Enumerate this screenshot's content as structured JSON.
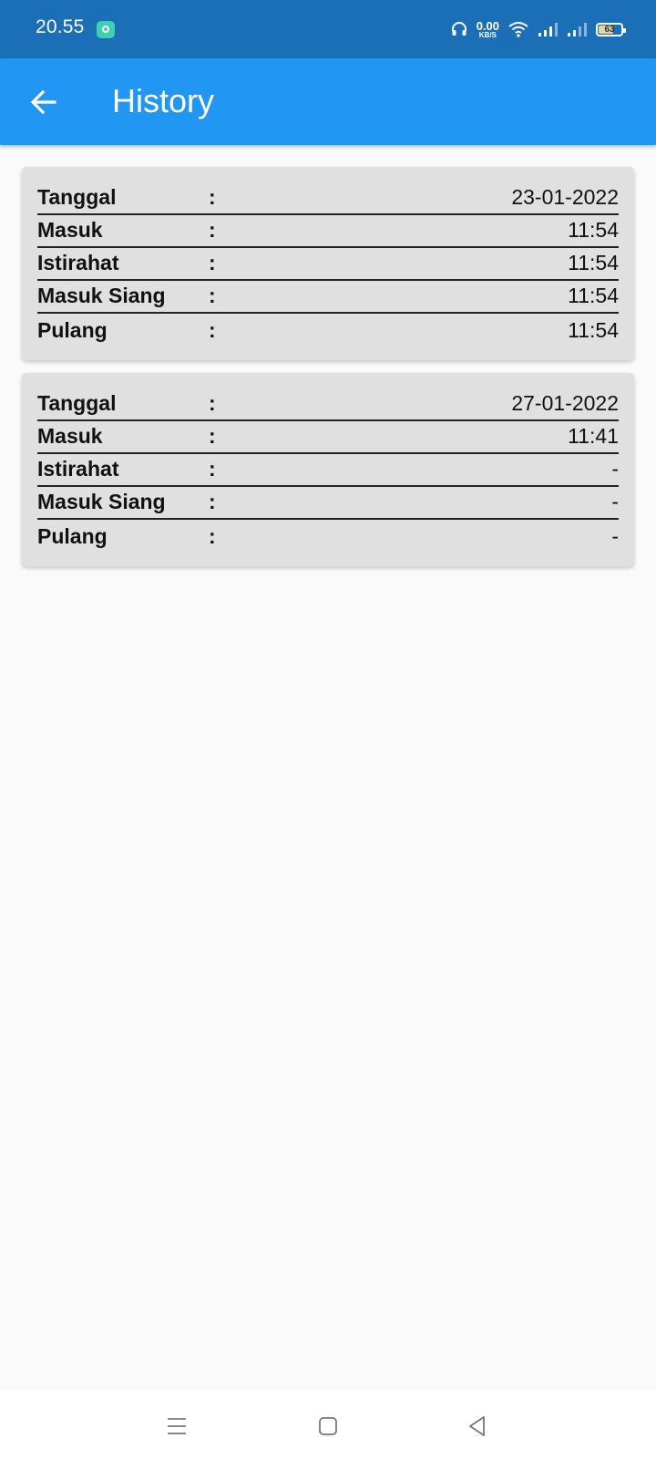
{
  "status_bar": {
    "time": "20.55",
    "net_speed_value": "0.00",
    "net_speed_unit": "KB/S",
    "battery": "63",
    "icons": [
      "notification-app-icon",
      "headphones-icon",
      "wifi-icon",
      "signal-icon",
      "signal-icon",
      "battery-icon"
    ]
  },
  "app_bar": {
    "title": "History",
    "back_icon": "arrow-left-icon",
    "background": "#2196f3"
  },
  "history": [
    {
      "rows": [
        {
          "label": "Tanggal",
          "sep": ":",
          "value": "23-01-2022"
        },
        {
          "label": "Masuk",
          "sep": ":",
          "value": "11:54"
        },
        {
          "label": "Istirahat",
          "sep": ":",
          "value": "11:54"
        },
        {
          "label": "Masuk Siang",
          "sep": ":",
          "value": "11:54"
        },
        {
          "label": "Pulang",
          "sep": ":",
          "value": "11:54"
        }
      ]
    },
    {
      "rows": [
        {
          "label": "Tanggal",
          "sep": ":",
          "value": "27-01-2022"
        },
        {
          "label": "Masuk",
          "sep": ":",
          "value": "11:41"
        },
        {
          "label": "Istirahat",
          "sep": ":",
          "value": "-"
        },
        {
          "label": "Masuk Siang",
          "sep": ":",
          "value": "-"
        },
        {
          "label": "Pulang",
          "sep": ":",
          "value": "-"
        }
      ]
    }
  ],
  "nav_bar": {
    "icons": [
      "menu-icon",
      "home-icon",
      "back-icon"
    ]
  }
}
